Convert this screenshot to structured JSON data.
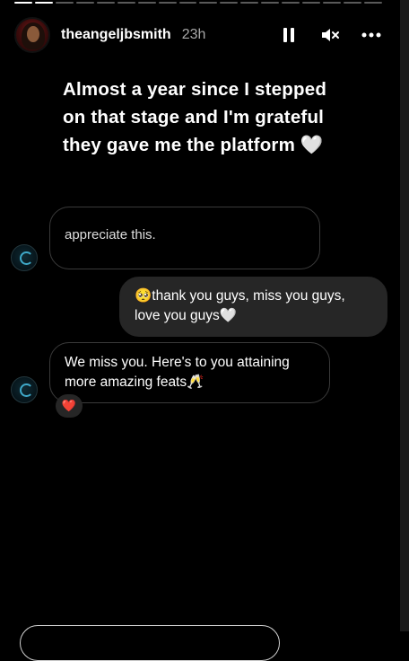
{
  "header": {
    "username": "theangeljbsmith",
    "time": "23h",
    "icons": [
      "pause-icon",
      "mute-icon",
      "more-icon"
    ]
  },
  "story": {
    "caption": "Almost a year since I stepped on that stage and I'm grateful they gave me the platform 🤍"
  },
  "messages": {
    "cut_off": "appreciate this.",
    "sent": "🥺thank you guys, miss you guys, love you guys🤍",
    "received": "We miss you. Here's to you attaining more amazing feats🥂",
    "reaction": "❤️"
  },
  "colors": {
    "background": "#000000",
    "sent_bubble": "#262626",
    "bubble_border": "#3a3a3a",
    "muted_text": "#a8a8a8"
  }
}
